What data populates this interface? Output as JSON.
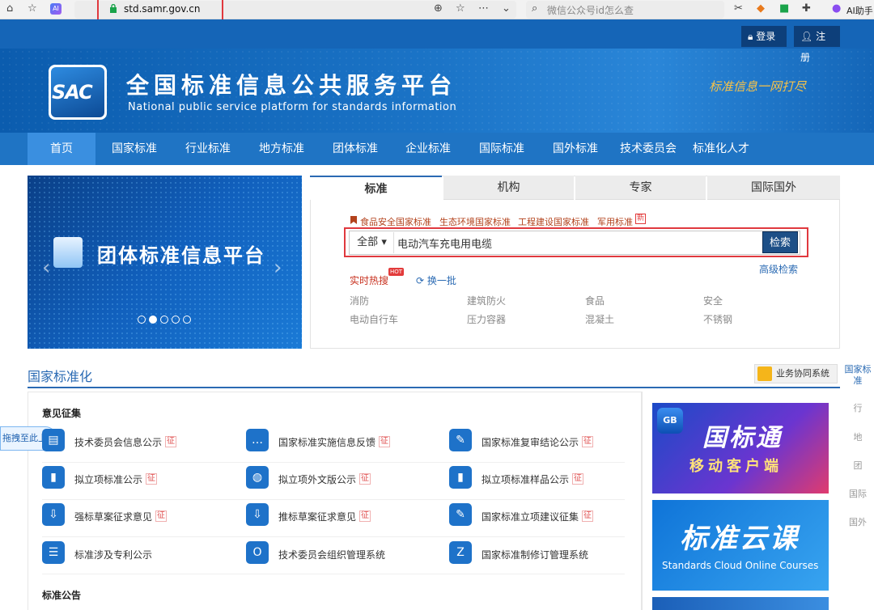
{
  "browser": {
    "url": "std.samr.gov.cn",
    "search_placeholder": "微信公众号id怎么查",
    "ai_label": "AI",
    "ai_assistant": "AI助手"
  },
  "header": {
    "login": "登录",
    "register": "注册",
    "logo_text": "SAC",
    "title": "全国标准信息公共服务平台",
    "subtitle": "National public service platform  for standards information",
    "slogan": "标准信息一网打尽"
  },
  "nav": [
    "首页",
    "国家标准",
    "行业标准",
    "地方标准",
    "团体标准",
    "企业标准",
    "国际标准",
    "国外标准",
    "技术委员会",
    "标准化人才"
  ],
  "banner": {
    "title": "团体标准信息平台"
  },
  "search": {
    "tabs": [
      "标准",
      "机构",
      "专家",
      "国际国外"
    ],
    "quick_links": [
      "食品安全国家标准",
      "生态环境国家标准",
      "工程建设国家标准",
      "军用标准"
    ],
    "new_badge": "新",
    "scope": "全部",
    "query": "电动汽车充电用电缆",
    "button": "检索",
    "advanced": "高级检索",
    "hot_label": "实时热搜",
    "hot_badge": "HOT",
    "refresh": "换一批",
    "hot_items": [
      "消防",
      "建筑防火",
      "食品",
      "安全",
      "电动自行车",
      "压力容器",
      "混凝土",
      "不锈钢"
    ]
  },
  "section": {
    "title": "国家标准化",
    "coop_button": "业务协同系统",
    "sub1": "意见征集",
    "sub2": "标准公告",
    "float_upload": "拖拽至此上传",
    "zheng": "征",
    "items": [
      {
        "label": "技术委员会信息公示",
        "zheng": true,
        "icon": "id-card-icon"
      },
      {
        "label": "国家标准实施信息反馈",
        "zheng": true,
        "icon": "chat-icon"
      },
      {
        "label": "国家标准复审结论公示",
        "zheng": true,
        "icon": "document-edit-icon"
      },
      {
        "label": "拟立项标准公示",
        "zheng": true,
        "icon": "book-icon"
      },
      {
        "label": "拟立项外文版公示",
        "zheng": true,
        "icon": "globe-icon"
      },
      {
        "label": "拟立项标准样品公示",
        "zheng": true,
        "icon": "book-icon"
      },
      {
        "label": "强标草案征求意见",
        "zheng": true,
        "icon": "download-monitor-icon"
      },
      {
        "label": "推标草案征求意见",
        "zheng": true,
        "icon": "download-monitor-icon"
      },
      {
        "label": "国家标准立项建议征集",
        "zheng": true,
        "icon": "edit-icon"
      },
      {
        "label": "标准涉及专利公示",
        "zheng": false,
        "icon": "patent-doc-icon"
      },
      {
        "label": "技术委员会组织管理系统",
        "zheng": false,
        "icon": "org-monitor-icon"
      },
      {
        "label": "国家标准制修订管理系统",
        "zheng": false,
        "icon": "zxd-monitor-icon"
      }
    ]
  },
  "promos": {
    "p1_badge": "GB",
    "p1_title": "国标通",
    "p1_sub": "移动客户端",
    "p2_title": "标准云课",
    "p2_sub": "Standards Cloud Online Courses"
  },
  "right_side": [
    "国家标准",
    "行",
    "地",
    "团",
    "国际",
    "国外"
  ],
  "colors": {
    "primary": "#1f74c4",
    "accent": "#2a6ab3",
    "highlight": "#e0393e"
  }
}
